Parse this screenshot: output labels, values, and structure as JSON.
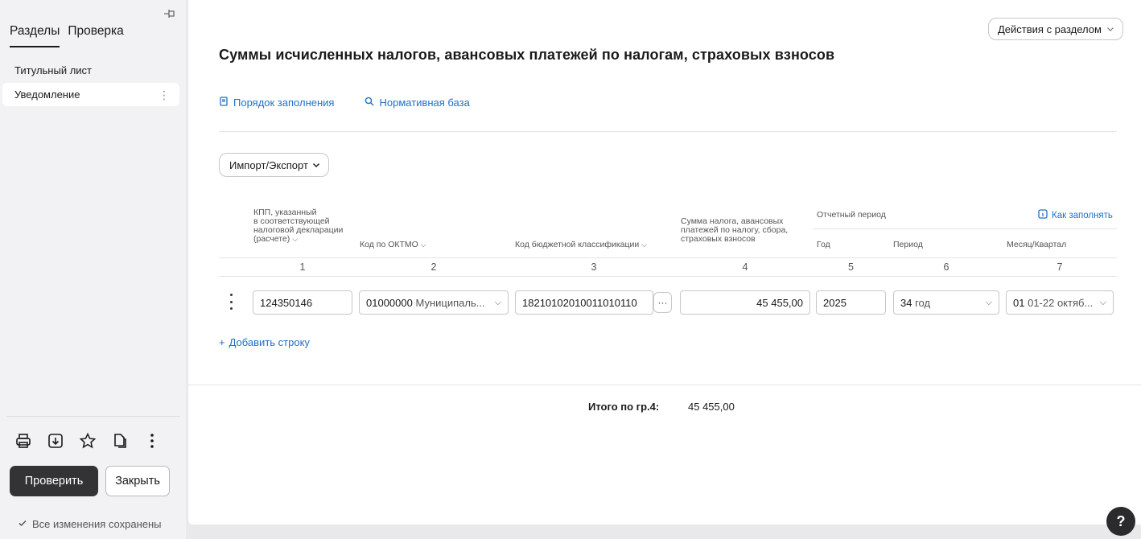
{
  "sidebar": {
    "tabs": [
      "Разделы",
      "Проверка"
    ],
    "items": [
      {
        "label": "Титульный лист"
      },
      {
        "label": "Уведомление"
      }
    ],
    "toolbar_icons": [
      "printer-icon",
      "download-icon",
      "star-icon",
      "copy-icon",
      "more-vertical-icon"
    ],
    "check_button": "Проверить",
    "close_button": "Закрыть",
    "saved_status": "Все изменения сохранены"
  },
  "header": {
    "actions_button": "Действия с разделом",
    "title": "Суммы исчисленных налогов, авансовых платежей по налогам, страховых взносов",
    "links": [
      "Порядок заполнения",
      "Нормативная база"
    ],
    "import_button": "Импорт/Экспорт"
  },
  "table": {
    "headers": {
      "kpp": [
        "КПП, указанный",
        "в соответствующей",
        "налоговой декларации",
        "(расчете)"
      ],
      "oktmo": "Код по ОКТМО",
      "kbk": "Код бюджетной классификации",
      "sum": [
        "Сумма налога, авансовых",
        "платежей по налогу, сбора,",
        "страховых взносов"
      ],
      "period_group": "Отчетный период",
      "year": "Год",
      "period": "Период",
      "month_quarter": "Месяц/Квартал",
      "how_to_fill": "Как заполнять"
    },
    "column_numbers": [
      "1",
      "2",
      "3",
      "4",
      "5",
      "6",
      "7"
    ],
    "rows": [
      {
        "kpp": "124350146",
        "oktmo_code": "01000000",
        "oktmo_name": "Муниципаль...",
        "kbk": "18210102010011010110",
        "sum": "45 455,00",
        "year": "2025",
        "period_code": "34",
        "period_name": "год",
        "month_code": "01",
        "month_name": "01-22 октяб..."
      }
    ],
    "add_row": "Добавить строку",
    "total_label": "Итого по гр.4:",
    "total_value": "45 455,00"
  },
  "help_label": "?",
  "colors": {
    "accent_link": "#1f6fc9",
    "primary_button": "#333336",
    "sidebar_bg": "#f2f2f4"
  }
}
